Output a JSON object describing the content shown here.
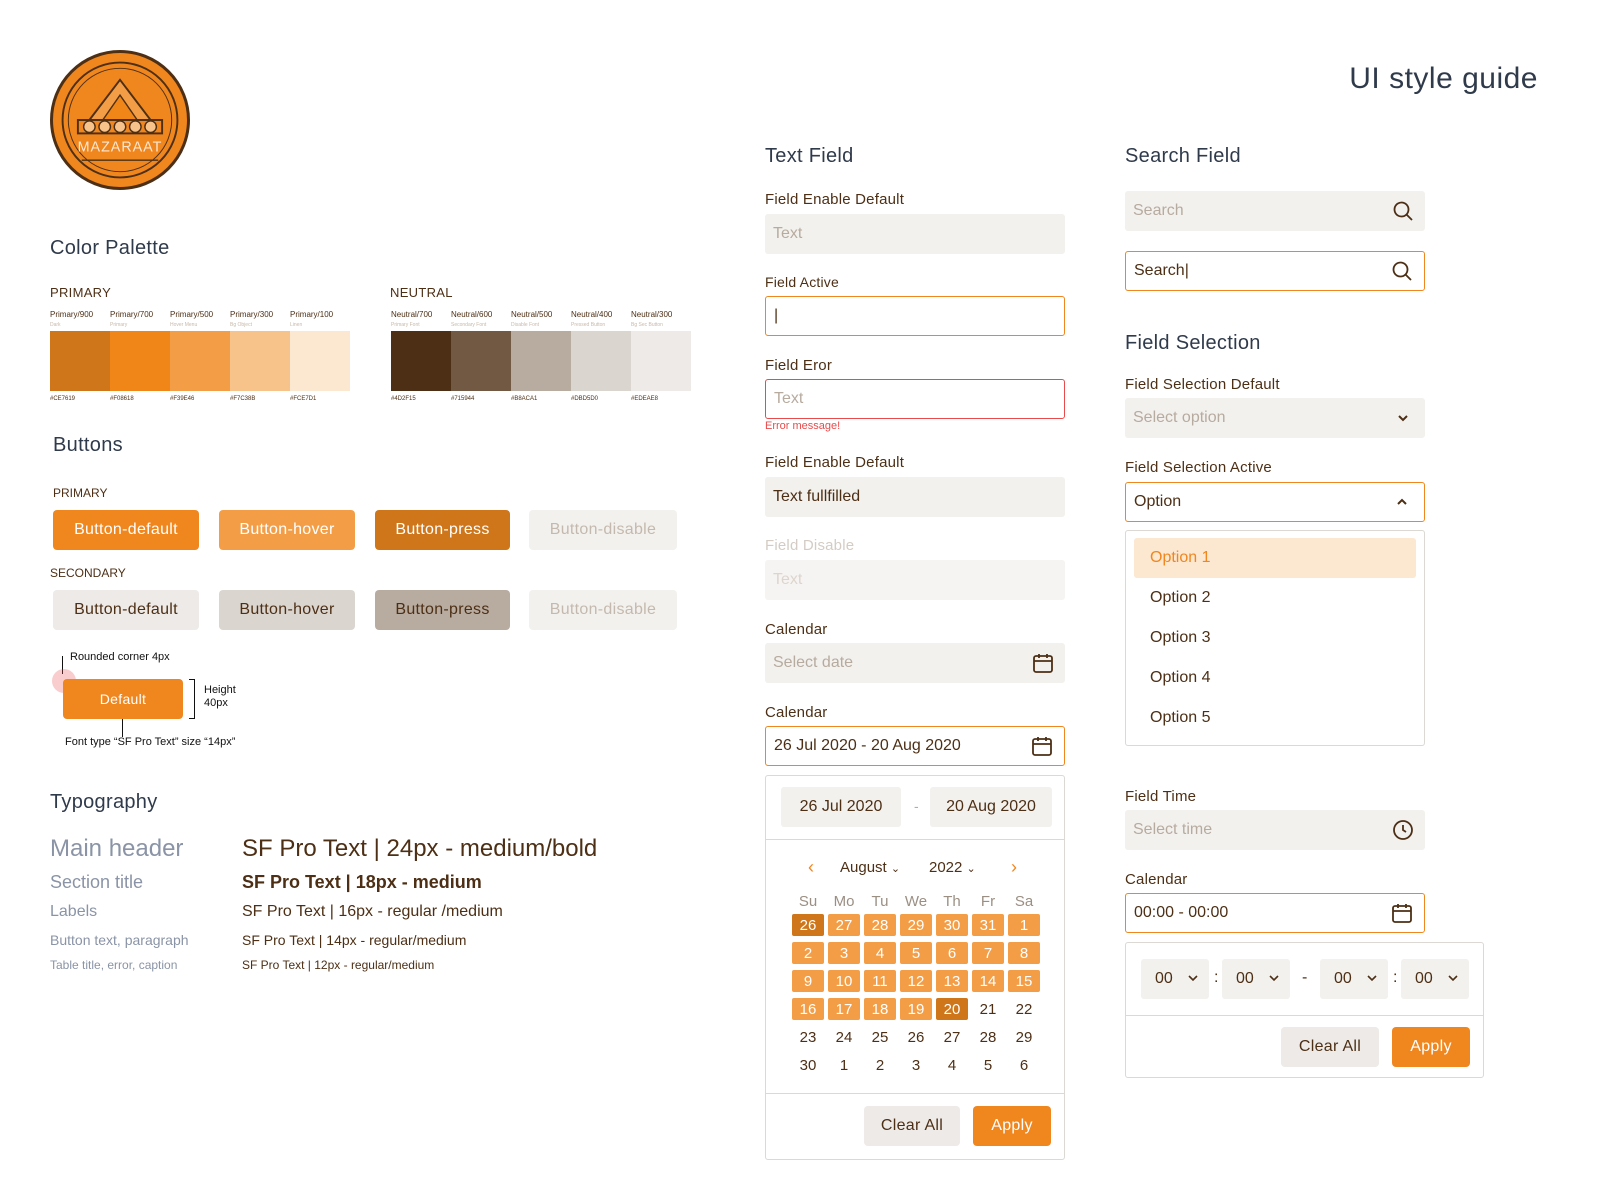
{
  "brand": {
    "logo_text": "MAZARAAT"
  },
  "page_title": "UI style guide",
  "palette": {
    "title": "Color Palette",
    "primary": {
      "heading": "PRIMARY",
      "swatches": [
        {
          "name": "Primary/900",
          "role": "Dark",
          "hex": "#CE7619"
        },
        {
          "name": "Primary/700",
          "role": "Primary",
          "hex": "#F08618"
        },
        {
          "name": "Primary/500",
          "role": "Hover Menu",
          "hex": "#F39E46"
        },
        {
          "name": "Primary/300",
          "role": "Bg Object",
          "hex": "#F7C38B"
        },
        {
          "name": "Primary/100",
          "role": "Linen",
          "hex": "#FCE7D1"
        }
      ]
    },
    "neutral": {
      "heading": "NEUTRAL",
      "swatches": [
        {
          "name": "Neutral/700",
          "role": "Primary Font",
          "hex": "#4D2F15"
        },
        {
          "name": "Neutral/600",
          "role": "Secondary Font",
          "hex": "#715944"
        },
        {
          "name": "Neutral/500",
          "role": "Disable Font",
          "hex": "#B8ACA1"
        },
        {
          "name": "Neutral/400",
          "role": "Pressed Button",
          "hex": "#DBD5D0"
        },
        {
          "name": "Neutral/300",
          "role": "Bg Sec Button",
          "hex": "#EDEAE8"
        }
      ]
    }
  },
  "buttons": {
    "title": "Buttons",
    "primary_heading": "PRIMARY",
    "secondary_heading": "SECONDARY",
    "labels": [
      "Button-default",
      "Button-hover",
      "Button-press",
      "Button-disable"
    ],
    "anno_corner": "Rounded corner 4px",
    "anno_default": "Default",
    "anno_height": "Height\n40px",
    "anno_font": "Font type “SF Pro Text” size “14px”"
  },
  "typography": {
    "title": "Typography",
    "rows": [
      {
        "label": "Main header",
        "spec": "SF Pro Text | 24px - medium/bold"
      },
      {
        "label": "Section title",
        "spec": "SF Pro Text | 18px - medium"
      },
      {
        "label": "Labels",
        "spec": "SF Pro Text | 16px - regular /medium"
      },
      {
        "label": "Button text, paragraph",
        "spec": "SF Pro Text | 14px - regular/medium"
      },
      {
        "label": "Table title, error, caption",
        "spec": "SF Pro Text | 12px - regular/medium"
      }
    ]
  },
  "text_field": {
    "title": "Text Field",
    "enable_label": "Field Enable Default",
    "enable_placeholder": "Text",
    "active_label": "Field Active",
    "active_value": "|",
    "error_label": "Field Eror",
    "error_placeholder": "Text",
    "error_message": "Error message!",
    "filled_label": "Field Enable Default",
    "filled_value": "Text fullfilled",
    "disable_label": "Field Disable",
    "disable_placeholder": "Text",
    "calendar_label": "Calendar",
    "calendar_placeholder": "Select date",
    "calendar2_label": "Calendar",
    "calendar2_value": "26 Jul 2020 - 20 Aug 2020"
  },
  "calendar": {
    "start": "26 Jul 2020",
    "dash": "-",
    "end": "20 Aug 2020",
    "month": "August",
    "year": "2022",
    "dow": [
      "Su",
      "Mo",
      "Tu",
      "We",
      "Th",
      "Fr",
      "Sa"
    ],
    "weeks": [
      [
        "26",
        "27",
        "28",
        "29",
        "30",
        "31",
        "1"
      ],
      [
        "2",
        "3",
        "4",
        "5",
        "6",
        "7",
        "8"
      ],
      [
        "9",
        "10",
        "11",
        "12",
        "13",
        "14",
        "15"
      ],
      [
        "16",
        "17",
        "18",
        "19",
        "20",
        "21",
        "22"
      ],
      [
        "23",
        "24",
        "25",
        "26",
        "27",
        "28",
        "29"
      ],
      [
        "30",
        "1",
        "2",
        "3",
        "4",
        "5",
        "6"
      ]
    ],
    "clear": "Clear All",
    "apply": "Apply"
  },
  "search": {
    "title": "Search Field",
    "placeholder": "Search",
    "active_value": "Search|"
  },
  "selection": {
    "title": "Field Selection",
    "default_label": "Field Selection Default",
    "default_placeholder": "Select option",
    "active_label": "Field Selection Active",
    "active_value": "Option",
    "options": [
      "Option 1",
      "Option 2",
      "Option 3",
      "Option 4",
      "Option 5"
    ]
  },
  "time": {
    "label": "Field Time",
    "placeholder": "Select time",
    "calendar_label": "Calendar",
    "calendar_value": "00:00 - 00:00",
    "h1": "00",
    "m1": "00",
    "h2": "00",
    "m2": "00",
    "colon": ":",
    "dash": "-",
    "clear": "Clear All",
    "apply": "Apply"
  }
}
